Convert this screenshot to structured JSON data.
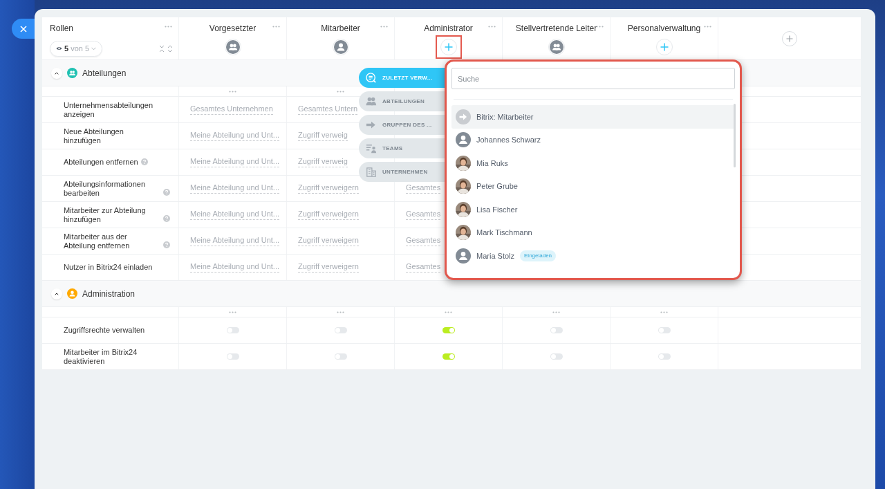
{
  "roles_panel": {
    "title": "Rollen",
    "visible_count": "5",
    "total": "von 5"
  },
  "roles": [
    {
      "name": "Vorgesetzter",
      "kind": "group",
      "highlighted": false
    },
    {
      "name": "Mitarbeiter",
      "kind": "user",
      "highlighted": false
    },
    {
      "name": "Administrator",
      "kind": "add",
      "highlighted": true
    },
    {
      "name": "Stellvertretende Leiter",
      "kind": "group",
      "highlighted": false
    },
    {
      "name": "Personalverwaltung",
      "kind": "add",
      "highlighted": false
    }
  ],
  "sections": [
    {
      "title": "Abteilungen",
      "color": "#1fc1b2",
      "expanded": true,
      "rows": [
        {
          "kind": "select",
          "label": "Unternehmensabteilungen anzeigen",
          "help": false,
          "cells": [
            "Gesamtes Unternehmen",
            "Gesamtes Untern",
            null,
            null,
            null
          ]
        },
        {
          "kind": "select",
          "label": "Neue Abteilungen hinzufügen",
          "help": false,
          "cells": [
            "Meine Abteilung und Unt...",
            "Zugriff verweig",
            null,
            null,
            null
          ]
        },
        {
          "kind": "select",
          "label": "Abteilungen entfernen",
          "help": true,
          "cells": [
            "Meine Abteilung und Unt...",
            "Zugriff verweig",
            null,
            null,
            null
          ]
        },
        {
          "kind": "select",
          "label": "Abteilungsinformationen bearbeiten",
          "help": true,
          "cells": [
            "Meine Abteilung und Unt...",
            "Zugriff verweigern",
            "Gesamtes",
            null,
            null
          ]
        },
        {
          "kind": "select",
          "label": "Mitarbeiter zur Abteilung hinzufügen",
          "help": true,
          "cells": [
            "Meine Abteilung und Unt...",
            "Zugriff verweigern",
            "Gesamtes",
            null,
            null
          ]
        },
        {
          "kind": "select",
          "label": "Mitarbeiter aus der Abteilung entfernen",
          "help": true,
          "cells": [
            "Meine Abteilung und Unt...",
            "Zugriff verweigern",
            "Gesamtes",
            null,
            null
          ]
        },
        {
          "kind": "select",
          "label": "Nutzer in Bitrix24 einladen",
          "help": false,
          "cells": [
            "Meine Abteilung und Unt...",
            "Zugriff verweigern",
            "Gesamtes",
            null,
            null
          ]
        }
      ]
    },
    {
      "title": "Administration",
      "color": "#ffa900",
      "expanded": true,
      "rows": [
        {
          "kind": "toggle",
          "label": "Zugriffsrechte verwalten",
          "help": false,
          "toggles": [
            false,
            false,
            true,
            false,
            false
          ]
        },
        {
          "kind": "toggle",
          "label": "Mitarbeiter im Bitrix24 deaktivieren",
          "help": false,
          "toggles": [
            false,
            false,
            true,
            false,
            false
          ]
        }
      ]
    }
  ],
  "source_tabs": [
    {
      "label": "ZULETZT VERW...",
      "selected": true
    },
    {
      "label": "ABTEILUNGEN",
      "selected": false
    },
    {
      "label": "GRUPPEN DES ...",
      "selected": false
    },
    {
      "label": "TEAMS",
      "selected": false
    },
    {
      "label": "UNTERNEHMEN",
      "selected": false
    }
  ],
  "picker": {
    "placeholder": "Suche",
    "items": [
      {
        "name": "Bitrix: Mitarbeiter",
        "kind": "group",
        "selected": true
      },
      {
        "name": "Johannes Schwarz",
        "kind": "user",
        "selected": false
      },
      {
        "name": "Mia Ruks",
        "selected": false
      },
      {
        "name": "Peter Grube",
        "selected": false
      },
      {
        "name": "Lisa Fischer",
        "selected": false
      },
      {
        "name": "Mark Tischmann",
        "selected": false
      },
      {
        "name": "Maria Stolz",
        "kind": "user",
        "selected": false,
        "badge": "Eingeladen"
      }
    ]
  }
}
